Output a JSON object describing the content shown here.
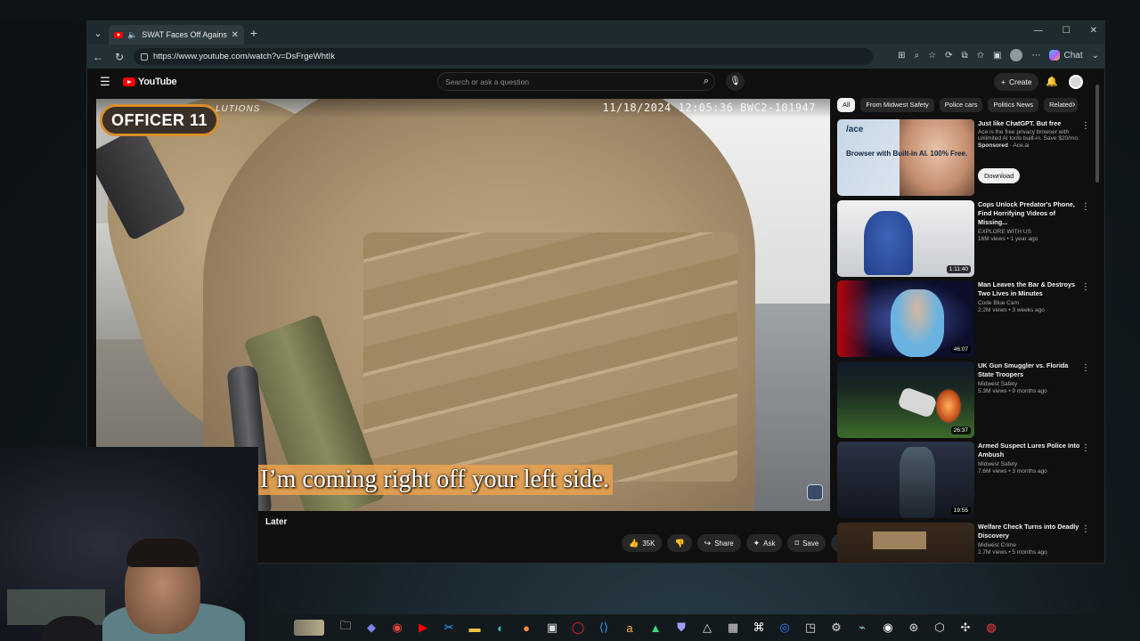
{
  "browser": {
    "tab_title": "SWAT Faces Off Against Killer",
    "url": "https://www.youtube.com/watch?v=DsFrgeWhtIk",
    "copilot_label": "Chat"
  },
  "youtube": {
    "logo_text": "YouTube",
    "search_placeholder": "Search or ask a question",
    "create_label": "Create"
  },
  "video": {
    "officer_badge": "OFFICER 11",
    "watermark": "LUTIONS",
    "timestamp": "11/18/2024 12:05:36   BWC2-101947",
    "caption": "I’m coming right off your left side.",
    "title_fragment": "Later",
    "likes": "35K",
    "share_label": "Share",
    "ask_label": "Ask",
    "save_label": "Save"
  },
  "chips": [
    "All",
    "From Midwest Safety",
    "Police cars",
    "Politics News",
    "Related"
  ],
  "ad": {
    "title": "Just like ChatGPT. But free",
    "desc": "Ace is the free privacy browser with unlimited AI tools built-in. Save $20/mo.",
    "sponsored": "Sponsored",
    "advertiser": "· Ace.ai",
    "download_label": "Download",
    "thumb_brand": "/ace",
    "thumb_text": "Browser with Built-in AI. 100% Free."
  },
  "recommendations": [
    {
      "title": "Cops Unlock Predator's Phone, Find Horrifying Videos of Missing...",
      "channel": "EXPLORE WITH US",
      "meta": "16M views • 1 year ago",
      "duration": "1:11:40"
    },
    {
      "title": "Man Leaves the Bar & Destroys Two Lives in Minutes",
      "channel": "Code Blue Cam",
      "meta": "2.2M views • 3 weeks ago",
      "duration": "46:07"
    },
    {
      "title": "UK Gun Smuggler vs. Florida State Troopers",
      "channel": "Midwest Safety",
      "meta": "5.3M views • 9 months ago",
      "duration": "26:37"
    },
    {
      "title": "Armed Suspect Lures Police Into Ambush",
      "channel": "Midwest Safety",
      "meta": "7.6M views • 3 months ago",
      "duration": "19:55"
    },
    {
      "title": "Welfare Check Turns into Deadly Discovery",
      "channel": "Midwest Crime",
      "meta": "2.7M views • 5 months ago",
      "duration": ""
    }
  ]
}
